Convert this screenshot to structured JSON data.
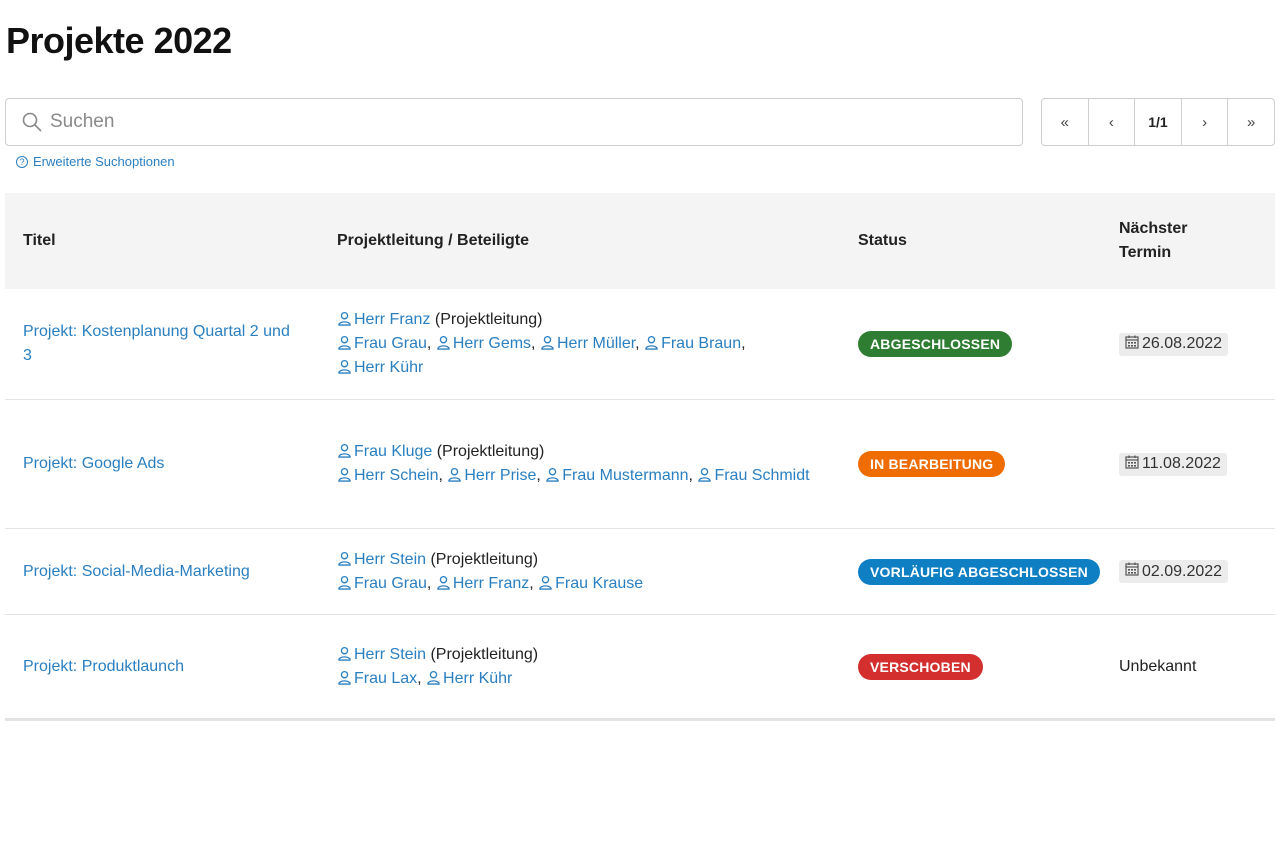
{
  "page": {
    "title": "Projekte 2022"
  },
  "search": {
    "placeholder": "Suchen",
    "value": "",
    "advanced_label": "Erweiterte Suchoptionen"
  },
  "pager": {
    "first": "«",
    "prev": "‹",
    "current": "1/1",
    "next": "›",
    "last": "»"
  },
  "table": {
    "headers": {
      "title": "Titel",
      "people": "Projektleitung / Beteiligte",
      "status": "Status",
      "next_date_line1": "Nächster",
      "next_date_line2": "Termin"
    },
    "rows": [
      {
        "title": "Projekt: Kostenplanung Quartal 2 und 3",
        "lead": "Herr Franz",
        "lead_suffix": " (Projektleitung)",
        "participants": [
          "Frau Grau",
          "Herr Gems",
          "Herr Müller",
          "Frau Braun",
          "Herr Kühr"
        ],
        "status": "ABGESCHLOSSEN",
        "status_color": "#2e7d32",
        "date": "26.08.2022"
      },
      {
        "title": "Projekt: Google Ads",
        "lead": "Frau Kluge",
        "lead_suffix": " (Projektleitung)",
        "participants": [
          "Herr Schein",
          "Herr Prise",
          "Frau Mustermann",
          "Frau Schmidt"
        ],
        "status": "IN BEARBEITUNG",
        "status_color": "#ef6c00",
        "date": "11.08.2022"
      },
      {
        "title": "Projekt: Social-Media-Marketing",
        "lead": "Herr Stein",
        "lead_suffix": " (Projektleitung)",
        "participants": [
          "Frau Grau",
          "Herr Franz",
          "Frau Krause"
        ],
        "status": "VORLÄUFIG ABGESCHLOSSEN",
        "status_color": "#0f7fc4",
        "date": "02.09.2022"
      },
      {
        "title": "Projekt: Produktlaunch",
        "lead": "Herr Stein",
        "lead_suffix": " (Projektleitung)",
        "participants": [
          "Frau Lax",
          "Herr Kühr"
        ],
        "status": "VERSCHOBEN",
        "status_color": "#d32f2f",
        "date": "Unbekannt"
      }
    ]
  },
  "colors": {
    "link": "#2a7fc1",
    "header_bg": "#f4f4f4",
    "border": "#cfcfcf"
  },
  "icons": {
    "search": "search-icon",
    "help": "help-icon",
    "person": "person-icon",
    "calendar": "calendar-icon"
  }
}
